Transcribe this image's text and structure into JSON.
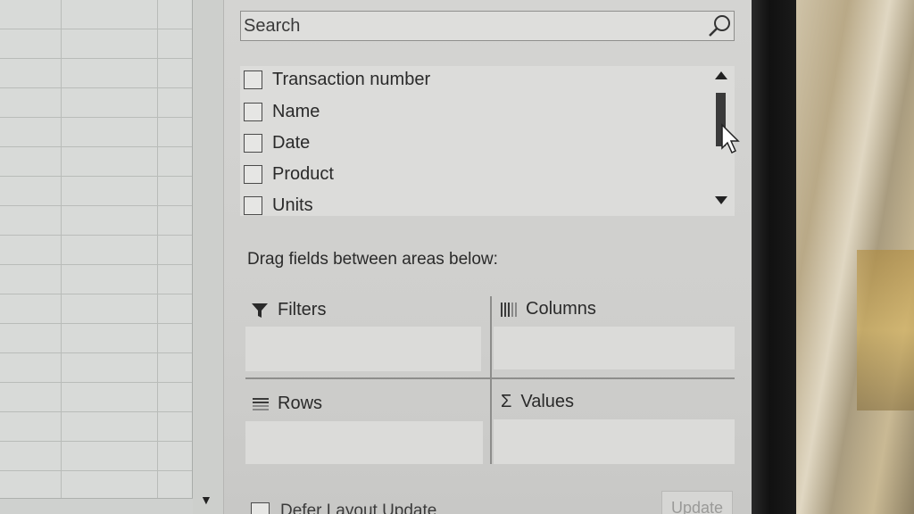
{
  "search": {
    "placeholder": "Search",
    "icon": "search-icon"
  },
  "fields": [
    {
      "label": "Transaction number",
      "checked": false
    },
    {
      "label": "Name",
      "checked": false
    },
    {
      "label": "Date",
      "checked": false
    },
    {
      "label": "Product",
      "checked": false
    },
    {
      "label": "Units",
      "checked": false
    }
  ],
  "drag_instruction": "Drag fields between areas below:",
  "areas": {
    "filters": {
      "label": "Filters",
      "icon": "filter-icon"
    },
    "columns": {
      "label": "Columns",
      "icon": "columns-icon"
    },
    "rows": {
      "label": "Rows",
      "icon": "rows-icon"
    },
    "values": {
      "label": "Values",
      "icon": "sigma-icon"
    }
  },
  "footer": {
    "defer_label": "Defer Layout Update",
    "update_label": "Update"
  }
}
